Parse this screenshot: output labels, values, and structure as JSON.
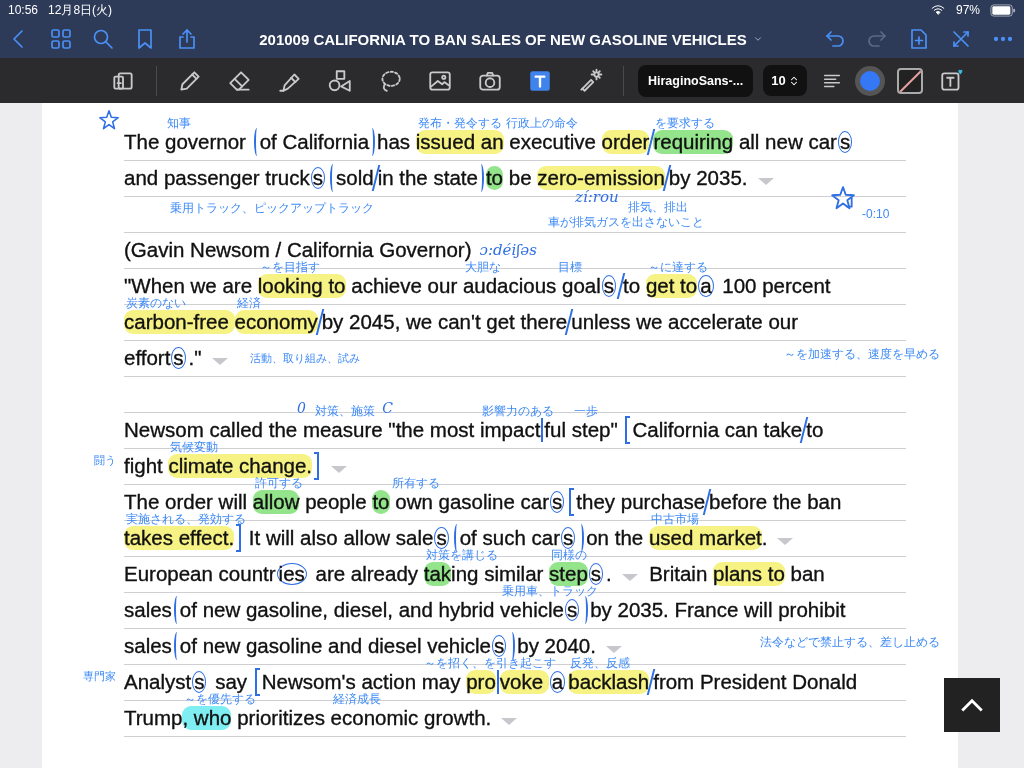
{
  "status_bar": {
    "time": "10:56",
    "date": "12月8日(火)",
    "battery": "97%"
  },
  "nav": {
    "left": [
      {
        "kind": "back"
      },
      {
        "kind": "grid"
      },
      {
        "kind": "search"
      },
      {
        "kind": "bookmark"
      },
      {
        "kind": "share"
      }
    ],
    "title": "201009 CALIFORNIA TO BAN SALES OF NEW GASOLINE VEHICLES",
    "right": [
      {
        "kind": "undo",
        "disabled": false
      },
      {
        "kind": "redo",
        "disabled": true
      },
      {
        "kind": "add-page",
        "disabled": false
      },
      {
        "kind": "close",
        "disabled": false
      },
      {
        "kind": "more",
        "disabled": false
      }
    ]
  },
  "toolbar": {
    "tools": [
      {
        "kind": "pages",
        "selected": false
      },
      {
        "kind": "pen",
        "selected": false
      },
      {
        "kind": "eraser",
        "selected": false
      },
      {
        "kind": "highlighter",
        "selected": false
      },
      {
        "kind": "shapes",
        "selected": false
      },
      {
        "kind": "lasso",
        "selected": false
      },
      {
        "kind": "image",
        "selected": false
      },
      {
        "kind": "camera",
        "selected": false
      },
      {
        "kind": "text",
        "selected": true
      },
      {
        "kind": "laser",
        "selected": false
      }
    ],
    "font": "HiraginoSans-...",
    "size": "10"
  },
  "rows": [
    {
      "kind": "text",
      "left": {
        "kind": "star"
      },
      "segments": [
        {
          "kind": "text",
          "text": "The "
        },
        {
          "kind": "text",
          "text": "governor ",
          "note": "知事"
        },
        {
          "kind": "paren-open"
        },
        {
          "kind": "text",
          "text": "of California"
        },
        {
          "kind": "paren-close"
        },
        {
          "kind": "text",
          "text": "has "
        },
        {
          "kind": "text",
          "text": "issued an",
          "color": "#f6f384",
          "note": "発布・発令する"
        },
        {
          "kind": "text",
          "text": " executive ",
          "note": "行政上の命令"
        },
        {
          "kind": "text",
          "text": "order",
          "color": "#f6f384"
        },
        {
          "kind": "slash"
        },
        {
          "kind": "text",
          "text": "requiring",
          "color": "#93e48b",
          "note": "を要求する"
        },
        {
          "kind": "text",
          "text": " all new car"
        },
        {
          "kind": "text",
          "text": "s",
          "circled": true
        }
      ]
    },
    {
      "kind": "text",
      "segments": [
        {
          "kind": "text",
          "text": "and passenger truck"
        },
        {
          "kind": "text",
          "text": "s",
          "circled": true
        },
        {
          "kind": "paren-open"
        },
        {
          "kind": "text",
          "text": "sold"
        },
        {
          "kind": "slash"
        },
        {
          "kind": "text",
          "text": "in the state"
        },
        {
          "kind": "paren-close"
        },
        {
          "kind": "text",
          "text": "to",
          "color": "#93e48b"
        },
        {
          "kind": "text",
          "text": " be "
        },
        {
          "kind": "text",
          "text": "zero-emission",
          "color": "#f6f384"
        },
        {
          "kind": "slash"
        },
        {
          "kind": "text",
          "text": "by 2035."
        },
        {
          "kind": "caret"
        }
      ]
    },
    {
      "kind": "blank",
      "notes": [
        {
          "kind": "note",
          "text": "乗用トラック、ピックアップトラック"
        },
        {
          "kind": "hand",
          "text": "zí:rou"
        },
        {
          "kind": "note",
          "text": "排気、排出"
        },
        {
          "kind": "note",
          "text": "車が排気ガスを出さないこと"
        },
        {
          "kind": "star"
        },
        {
          "kind": "note",
          "text": "-0:10"
        }
      ]
    },
    {
      "kind": "text",
      "segments": [
        {
          "kind": "text",
          "text": "(Gavin Newsom / California Governor)"
        },
        {
          "kind": "hand",
          "text": "ɔ:déiʃəs"
        }
      ]
    },
    {
      "kind": "text",
      "segments": [
        {
          "kind": "text",
          "text": "\"When we are "
        },
        {
          "kind": "text",
          "text": "looking to",
          "color": "#f6f384",
          "note": "～を目指す"
        },
        {
          "kind": "text",
          "text": " achieve our "
        },
        {
          "kind": "text",
          "text": "audacious",
          "note": "大胆な"
        },
        {
          "kind": "text",
          "text": " goal",
          "note": "目標"
        },
        {
          "kind": "text",
          "text": "s",
          "circled": true
        },
        {
          "kind": "slash"
        },
        {
          "kind": "text",
          "text": "to "
        },
        {
          "kind": "text",
          "text": "get to",
          "color": "#f6f384",
          "note": "～に達する"
        },
        {
          "kind": "text",
          "text": "a",
          "circled": true
        },
        {
          "kind": "text",
          "text": " 100 percent"
        }
      ]
    },
    {
      "kind": "text",
      "segments": [
        {
          "kind": "text",
          "text": "carbon-free ",
          "color": "#f6f384",
          "note": "炭素のない"
        },
        {
          "kind": "text",
          "text": "economy",
          "color": "#f6f384",
          "note": "経済"
        },
        {
          "kind": "slash"
        },
        {
          "kind": "text",
          "text": "by 2045, we can't get there"
        },
        {
          "kind": "slash"
        },
        {
          "kind": "text",
          "text": "unless we accelerate our"
        }
      ]
    },
    {
      "kind": "text",
      "right": {
        "kind": "note",
        "text": "～を加速する、速度を早める"
      },
      "segments": [
        {
          "kind": "text",
          "text": "effort"
        },
        {
          "kind": "text",
          "text": "s",
          "circled": true
        },
        {
          "kind": "text",
          "text": ".\""
        },
        {
          "kind": "caret"
        },
        {
          "kind": "inline-note",
          "text": "活動、取り組み、試み"
        }
      ]
    },
    {
      "kind": "blank",
      "notes": []
    },
    {
      "kind": "text",
      "segments": [
        {
          "kind": "text",
          "text": "Newsom called the "
        },
        {
          "kind": "text",
          "text": "measure ",
          "note": "対策、施策",
          "hand": "0"
        },
        {
          "kind": "text",
          "text": "\"the",
          "hand": "C"
        },
        {
          "kind": "text",
          "text": " most "
        },
        {
          "kind": "text",
          "text": "impact",
          "note": "影響力のある"
        },
        {
          "kind": "tick"
        },
        {
          "kind": "text",
          "text": "ful "
        },
        {
          "kind": "text",
          "text": "step\" ",
          "note": "一歩"
        },
        {
          "kind": "bracket-open"
        },
        {
          "kind": "text",
          "text": "California can take"
        },
        {
          "kind": "slash"
        },
        {
          "kind": "text",
          "text": "to"
        }
      ]
    },
    {
      "kind": "text",
      "left": {
        "kind": "note",
        "text": "闘う"
      },
      "segments": [
        {
          "kind": "text",
          "text": "fight "
        },
        {
          "kind": "text",
          "text": "climate change.",
          "color": "#f6f384",
          "note": "気候変動"
        },
        {
          "kind": "bracket-close"
        },
        {
          "kind": "caret"
        }
      ]
    },
    {
      "kind": "text",
      "segments": [
        {
          "kind": "text",
          "text": "The order will "
        },
        {
          "kind": "text",
          "text": "allow",
          "color": "#93e48b",
          "note": "許可する"
        },
        {
          "kind": "text",
          "text": " people "
        },
        {
          "kind": "text",
          "text": "to",
          "color": "#93e48b"
        },
        {
          "kind": "text",
          "text": " own",
          "note": "所有する"
        },
        {
          "kind": "text",
          "text": " gasoline car"
        },
        {
          "kind": "text",
          "text": "s",
          "circled": true
        },
        {
          "kind": "bracket-open"
        },
        {
          "kind": "text",
          "text": "they purchase"
        },
        {
          "kind": "slash"
        },
        {
          "kind": "text",
          "text": "before the ban"
        }
      ]
    },
    {
      "kind": "text",
      "segments": [
        {
          "kind": "text",
          "text": "takes effect.",
          "color": "#f6f384",
          "note": "実施される、発効する"
        },
        {
          "kind": "bracket-close"
        },
        {
          "kind": "text",
          "text": " It will also allow sale"
        },
        {
          "kind": "text",
          "text": "s",
          "circled": true
        },
        {
          "kind": "paren-open"
        },
        {
          "kind": "text",
          "text": "of such car"
        },
        {
          "kind": "text",
          "text": "s",
          "circled": true
        },
        {
          "kind": "paren-close"
        },
        {
          "kind": "text",
          "text": "on the "
        },
        {
          "kind": "text",
          "text": "used market",
          "color": "#f6f384",
          "note": "中古市場"
        },
        {
          "kind": "text",
          "text": "."
        },
        {
          "kind": "caret"
        }
      ]
    },
    {
      "kind": "text",
      "segments": [
        {
          "kind": "text",
          "text": "European countr"
        },
        {
          "kind": "text",
          "text": "ies",
          "circled": true
        },
        {
          "kind": "text",
          "text": " are already "
        },
        {
          "kind": "text",
          "text": "tak",
          "color": "#93e48b",
          "note": "対策を講じる"
        },
        {
          "kind": "text",
          "text": "ing "
        },
        {
          "kind": "text",
          "text": "similar "
        },
        {
          "kind": "text",
          "text": "step",
          "color": "#93e48b",
          "note": "同様の"
        },
        {
          "kind": "text",
          "text": "s",
          "circled": true
        },
        {
          "kind": "text",
          "text": "."
        },
        {
          "kind": "caret"
        },
        {
          "kind": "text",
          "text": "  Britain "
        },
        {
          "kind": "text",
          "text": "plans to",
          "color": "#f6f384"
        },
        {
          "kind": "text",
          "text": " ban"
        }
      ]
    },
    {
      "kind": "text",
      "segments": [
        {
          "kind": "text",
          "text": "sales"
        },
        {
          "kind": "paren-open"
        },
        {
          "kind": "text",
          "text": "of new gasoline, diesel, and hybrid "
        },
        {
          "kind": "text",
          "text": "vehicle",
          "note": "乗用車、トラック"
        },
        {
          "kind": "text",
          "text": "s",
          "circled": true
        },
        {
          "kind": "paren-close"
        },
        {
          "kind": "text",
          "text": "by 2035. France will prohibit"
        }
      ]
    },
    {
      "kind": "text",
      "right": {
        "kind": "note",
        "text": "法令などで禁止する、差し止める"
      },
      "segments": [
        {
          "kind": "text",
          "text": "sales"
        },
        {
          "kind": "paren-open"
        },
        {
          "kind": "text",
          "text": "of new gasoline and diesel vehicle"
        },
        {
          "kind": "text",
          "text": "s",
          "circled": true
        },
        {
          "kind": "paren-close"
        },
        {
          "kind": "text",
          "text": "by 2040."
        },
        {
          "kind": "caret"
        }
      ]
    },
    {
      "kind": "text",
      "left": {
        "kind": "note",
        "text": "専門家"
      },
      "segments": [
        {
          "kind": "text",
          "text": "Analyst"
        },
        {
          "kind": "text",
          "text": "s",
          "circled": true
        },
        {
          "kind": "text",
          "text": " say "
        },
        {
          "kind": "bracket-open"
        },
        {
          "kind": "text",
          "text": "Newsom's action "
        },
        {
          "kind": "text",
          "text": "may ",
          "note": "～を招く、を引き起こす"
        },
        {
          "kind": "text",
          "text": "pro",
          "color": "#f6f384"
        },
        {
          "kind": "tick"
        },
        {
          "kind": "text",
          "text": "voke ",
          "color": "#f6f384"
        },
        {
          "kind": "text",
          "text": "a",
          "circled": true
        },
        {
          "kind": "text",
          "text": "backlash",
          "color": "#f6f384",
          "note": "反発、反感"
        },
        {
          "kind": "slash"
        },
        {
          "kind": "text",
          "text": "from President Donald"
        }
      ]
    },
    {
      "kind": "text",
      "segments": [
        {
          "kind": "text",
          "text": "Trump"
        },
        {
          "kind": "text",
          "text": ", who",
          "color": "#7eeef2",
          "note": "～を優先する"
        },
        {
          "kind": "text",
          "text": " prioritizes "
        },
        {
          "kind": "text",
          "text": "economic",
          "note": "経済成長"
        },
        {
          "kind": "text",
          "text": " growth."
        },
        {
          "kind": "caret"
        }
      ]
    }
  ]
}
